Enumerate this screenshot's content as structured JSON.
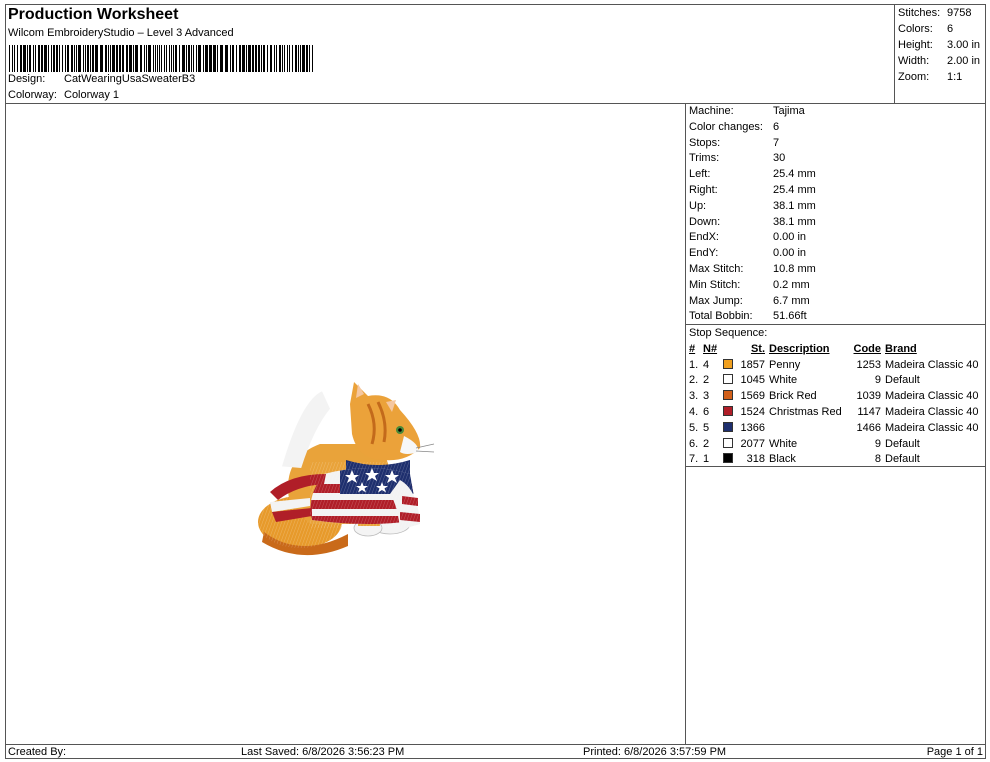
{
  "header": {
    "title": "Production Worksheet",
    "subtitle": "Wilcom EmbroideryStudio – Level 3 Advanced",
    "design_label": "Design:",
    "design_value": "CatWearingUsaSweaterB3",
    "colorway_label": "Colorway:",
    "colorway_value": "Colorway 1"
  },
  "summary": [
    {
      "label": "Stitches:",
      "value": "9758"
    },
    {
      "label": "Colors:",
      "value": "6"
    },
    {
      "label": "Height:",
      "value": "3.00 in"
    },
    {
      "label": "Width:",
      "value": "2.00 in"
    },
    {
      "label": "Zoom:",
      "value": "1:1"
    }
  ],
  "properties": [
    {
      "label": "Machine:",
      "value": "Tajima"
    },
    {
      "label": "Color changes:",
      "value": "6"
    },
    {
      "label": "Stops:",
      "value": "7"
    },
    {
      "label": "Trims:",
      "value": "30"
    },
    {
      "label": "Left:",
      "value": "25.4 mm"
    },
    {
      "label": "Right:",
      "value": "25.4 mm"
    },
    {
      "label": "Up:",
      "value": "38.1 mm"
    },
    {
      "label": "Down:",
      "value": "38.1 mm"
    },
    {
      "label": "EndX:",
      "value": "0.00 in"
    },
    {
      "label": "EndY:",
      "value": "0.00 in"
    },
    {
      "label": "Max Stitch:",
      "value": "10.8 mm"
    },
    {
      "label": "Min Stitch:",
      "value": "0.2 mm"
    },
    {
      "label": "Max Jump:",
      "value": "6.7 mm"
    },
    {
      "label": "Total Bobbin:",
      "value": "51.66ft"
    }
  ],
  "stop_sequence": {
    "caption": "Stop Sequence:",
    "columns": [
      "#",
      "N#",
      "St.",
      "Description",
      "Code",
      "Brand"
    ],
    "rows": [
      {
        "idx": "1.",
        "n": "4",
        "color": "#F0A020",
        "st": "1857",
        "desc": "Penny",
        "code": "1253",
        "brand": "Madeira Classic 40"
      },
      {
        "idx": "2.",
        "n": "2",
        "color": "#FFFFFF",
        "st": "1045",
        "desc": "White",
        "code": "9",
        "brand": "Default"
      },
      {
        "idx": "3.",
        "n": "3",
        "color": "#D2601A",
        "st": "1569",
        "desc": "Brick Red",
        "code": "1039",
        "brand": "Madeira Classic 40"
      },
      {
        "idx": "4.",
        "n": "6",
        "color": "#B01E28",
        "st": "1524",
        "desc": "Christmas Red",
        "code": "1147",
        "brand": "Madeira Classic 40"
      },
      {
        "idx": "5.",
        "n": "5",
        "color": "#1E2F6E",
        "st": "1366",
        "desc": "",
        "code": "1466",
        "brand": "Madeira Classic 40"
      },
      {
        "idx": "6.",
        "n": "2",
        "color": "#FFFFFF",
        "st": "2077",
        "desc": "White",
        "code": "9",
        "brand": "Default"
      },
      {
        "idx": "7.",
        "n": "1",
        "color": "#000000",
        "st": "318",
        "desc": "Black",
        "code": "8",
        "brand": "Default"
      }
    ]
  },
  "footer": {
    "created_by": "Created By:",
    "last_saved": "Last Saved: 6/8/2026 3:56:23 PM",
    "printed": "Printed: 6/8/2026 3:57:59 PM",
    "page": "Page 1 of 1"
  }
}
